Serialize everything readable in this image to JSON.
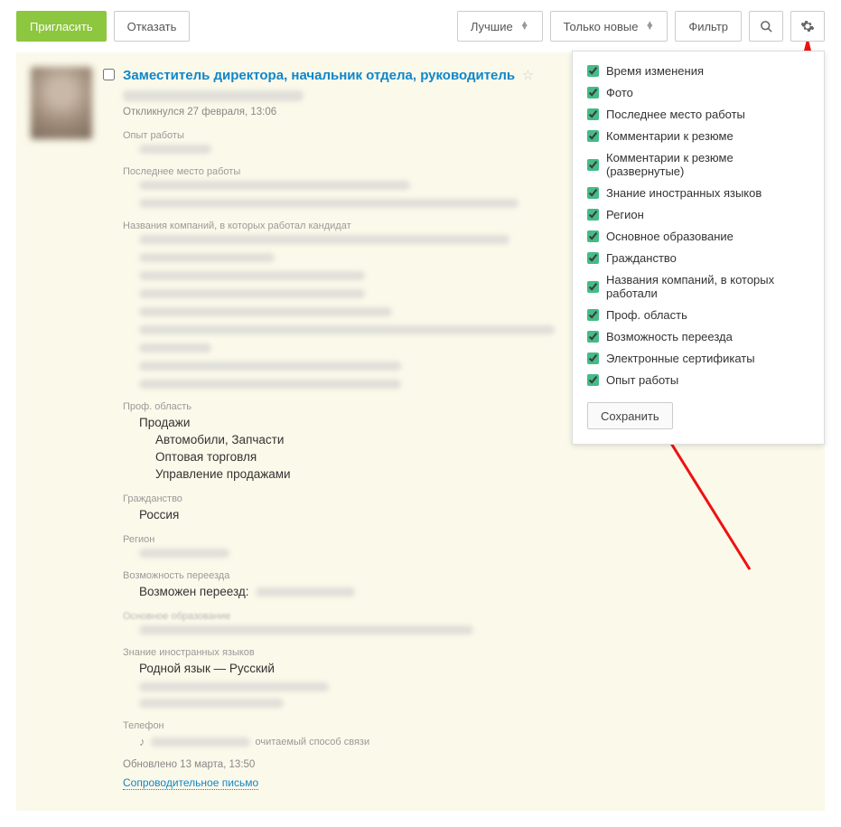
{
  "toolbar": {
    "invite": "Пригласить",
    "reject": "Отказать",
    "best": "Лучшие",
    "only_new": "Только новые",
    "filter": "Фильтр",
    "search_icon": "search-icon",
    "gear_icon": "gear-icon"
  },
  "resume": {
    "title": "Заместитель директора, начальник отдела, руководитель",
    "applied": "Откликнулся 27 февраля, 13:06",
    "labels": {
      "experience": "Опыт работы",
      "last_job": "Последнее место работы",
      "companies": "Названия компаний, в которых работал кандидат",
      "prof_area": "Проф. область",
      "citizenship": "Гражданство",
      "region": "Регион",
      "relocation": "Возможность переезда",
      "education": "Основное образование",
      "languages": "Знание иностранных языков",
      "phone": "Телефон"
    },
    "prof_area": {
      "main": "Продажи",
      "subs": [
        "Автомобили, Запчасти",
        "Оптовая торговля",
        "Управление продажами"
      ]
    },
    "citizenship": "Россия",
    "relocation_prefix": "Возможен переезд:",
    "languages_native": "Родной язык — Русский",
    "phone_pref_suffix": "очитаемый способ связи",
    "updated": "Обновлено 13 марта, 13:50",
    "cover_letter": "Сопроводительное письмо"
  },
  "settings": {
    "options": [
      "Время изменения",
      "Фото",
      "Последнее место работы",
      "Комментарии к резюме",
      "Комментарии к резюме (развернутые)",
      "Знание иностранных языков",
      "Регион",
      "Основное образование",
      "Гражданство",
      "Названия компаний, в которых работали",
      "Проф. область",
      "Возможность переезда",
      "Электронные сертификаты",
      "Опыт работы"
    ],
    "save": "Сохранить"
  }
}
